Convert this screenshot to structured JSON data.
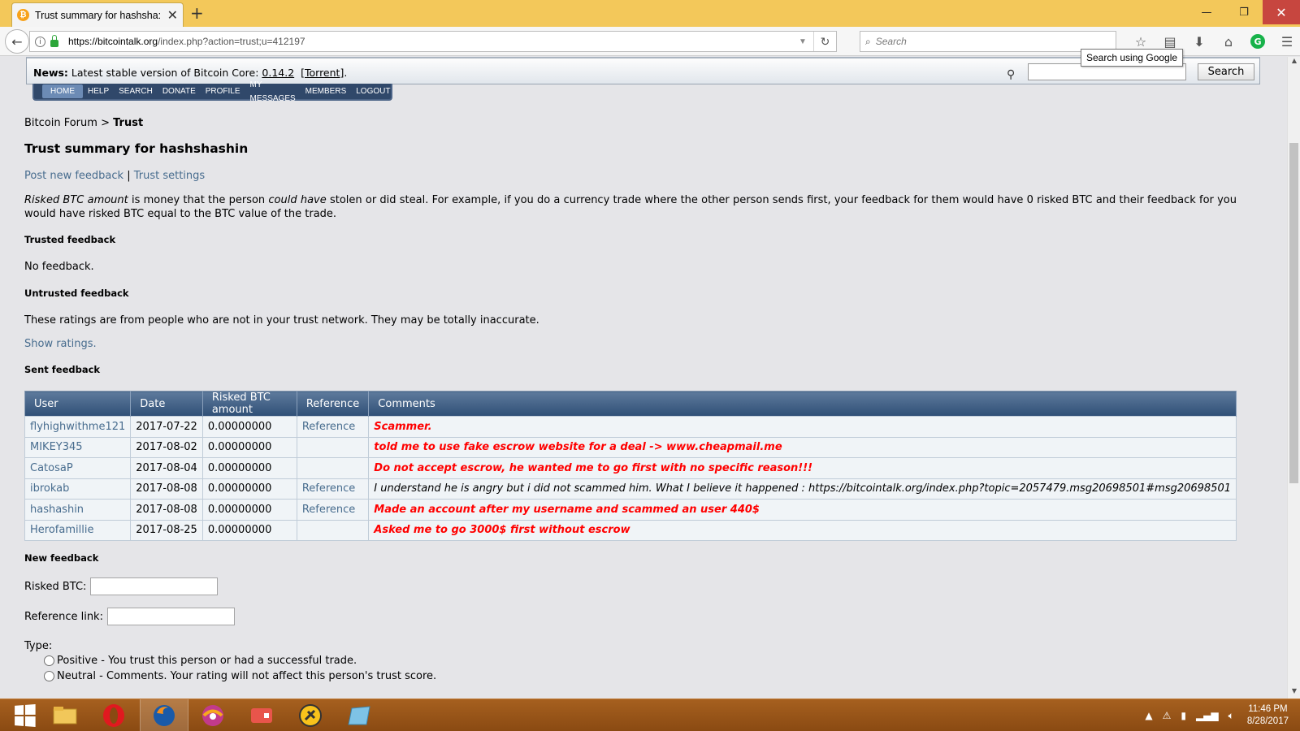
{
  "browser": {
    "tab_title": "Trust summary for hashsha:",
    "url_host": "https://bitcointalk.org",
    "url_path": "/index.php?action=trust;u=412197",
    "search_placeholder": "Search",
    "tooltip": "Search using Google"
  },
  "forum": {
    "news_label": "News:",
    "news_text": " Latest stable version of Bitcoin Core: ",
    "news_version": "0.14.2",
    "news_torrent": "[Torrent]",
    "news_end": ".",
    "search_button": "Search",
    "menu": [
      "HOME",
      "HELP",
      "SEARCH",
      "DONATE",
      "PROFILE",
      "MY MESSAGES",
      "MEMBERS",
      "LOGOUT"
    ]
  },
  "breadcrumb": {
    "root": "Bitcoin Forum",
    "sep": " > ",
    "current": "Trust"
  },
  "page_title": "Trust summary for hashshashin",
  "links": {
    "post_feedback": "Post new feedback",
    "sep": " | ",
    "settings": "Trust settings"
  },
  "description": {
    "em1": "Risked BTC amount",
    "t1": " is money that the person ",
    "em2": "could have",
    "t2": " stolen or did steal. For example, if you do a currency trade where the other person sends first, your feedback for them would have 0 risked BTC and their feedback for you would have risked BTC equal to the BTC value of the trade."
  },
  "trusted": {
    "heading": "Trusted feedback",
    "text": "No feedback."
  },
  "untrusted": {
    "heading": "Untrusted feedback",
    "text": "These ratings are from people who are not in your trust network. They may be totally inaccurate.",
    "show": "Show ratings."
  },
  "sent": {
    "heading": "Sent feedback",
    "columns": [
      "User",
      "Date",
      "Risked BTC amount",
      "Reference",
      "Comments"
    ],
    "rows": [
      {
        "user": "flyhighwithme121",
        "date": "2017-07-22",
        "risked": "0.00000000",
        "reference": "Reference",
        "comment": "Scammer.",
        "negative": true
      },
      {
        "user": "MIKEY345",
        "date": "2017-08-02",
        "risked": "0.00000000",
        "reference": "",
        "comment": "told me to use fake escrow website for a deal -> www.cheapmail.me",
        "negative": true
      },
      {
        "user": "CatosaP",
        "date": "2017-08-04",
        "risked": "0.00000000",
        "reference": "",
        "comment": "Do not accept escrow, he wanted me to go first with no specific reason!!!",
        "negative": true
      },
      {
        "user": "ibrokab",
        "date": "2017-08-08",
        "risked": "0.00000000",
        "reference": "Reference",
        "comment": "I understand he is angry but i did not scammed him. What I believe it happened : https://bitcointalk.org/index.php?topic=2057479.msg20698501#msg20698501",
        "negative": false
      },
      {
        "user": "hashashin",
        "date": "2017-08-08",
        "risked": "0.00000000",
        "reference": "Reference",
        "comment": "Made an account after my username and scammed an user 440$",
        "negative": true
      },
      {
        "user": "Herofamillie",
        "date": "2017-08-25",
        "risked": "0.00000000",
        "reference": "",
        "comment": "Asked me to go 3000$ first without escrow",
        "negative": true
      }
    ]
  },
  "new_feedback": {
    "heading": "New feedback",
    "risked_label": "Risked BTC:",
    "reference_label": "Reference link:",
    "type_label": "Type:",
    "positive": "Positive - You trust this person or had a successful trade.",
    "neutral": "Neutral - Comments. Your rating will not affect this person's trust score."
  },
  "taskbar": {
    "time": "11:46 PM",
    "date": "8/28/2017"
  }
}
